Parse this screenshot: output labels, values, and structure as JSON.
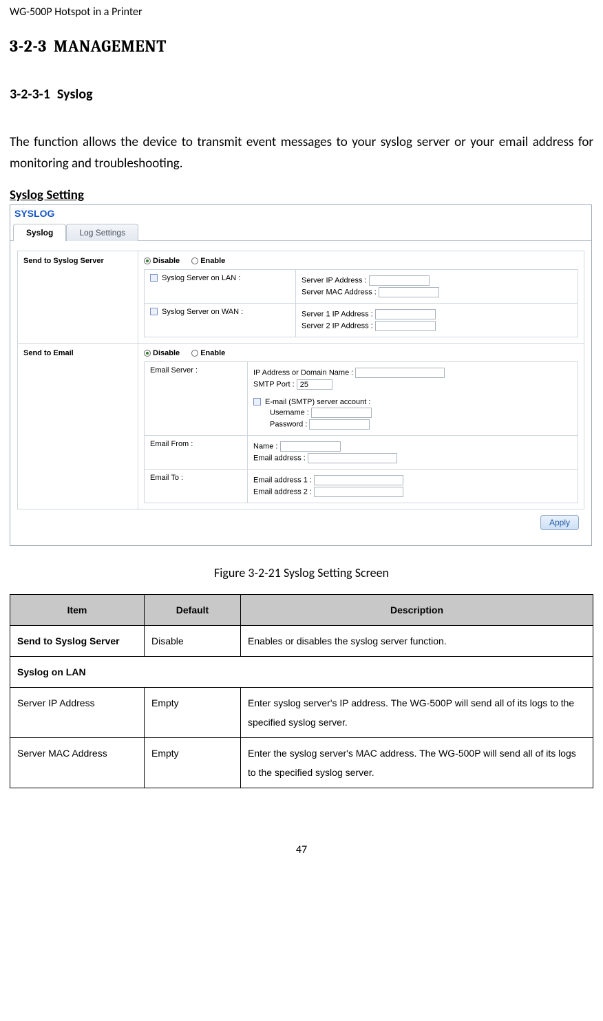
{
  "doc_header": "WG-500P Hotspot in a Printer",
  "section": {
    "num": "3-2-3",
    "title": "MANAGEMENT"
  },
  "subsection": {
    "num": "3-2-3-1",
    "title": "Syslog"
  },
  "intro": "The function allows the device to transmit event messages to your syslog server or your email address for monitoring and troubleshooting.",
  "setting_heading": "Syslog Setting",
  "shot": {
    "title": "SYSLOG",
    "tabs": {
      "active": "Syslog",
      "inactive": "Log Settings"
    },
    "row_syslog_label": "Send to Syslog Server",
    "radio_disable": "Disable",
    "radio_enable": "Enable",
    "lan_label": "Syslog Server on LAN :",
    "lan_ip": "Server IP Address :",
    "lan_mac": "Server MAC Address :",
    "wan_label": "Syslog Server on WAN :",
    "wan_ip1": "Server 1 IP Address :",
    "wan_ip2": "Server 2 IP Address :",
    "row_email_label": "Send to Email",
    "email_server_label": "Email Server :",
    "email_ipdomain": "IP Address or Domain Name :",
    "email_smtp": "SMTP Port :",
    "email_smtp_val": "25",
    "email_acct": "E-mail (SMTP) server account :",
    "email_user": "Username :",
    "email_pass": "Password :",
    "email_from_label": "Email From :",
    "email_from_name": "Name :",
    "email_from_addr": "Email address :",
    "email_to_label": "Email To :",
    "email_to1": "Email address 1 :",
    "email_to2": "Email address 2 :",
    "apply": "Apply"
  },
  "figure_caption": "Figure 3-2-21 Syslog Setting Screen",
  "table": {
    "headers": {
      "item": "Item",
      "def": "Default",
      "desc": "Description"
    },
    "rows": [
      {
        "item": "Send to Syslog Server",
        "def": "Disable",
        "desc": "Enables or disables the syslog server function.",
        "bold_item": true
      },
      {
        "section": "Syslog on LAN"
      },
      {
        "item": "Server IP Address",
        "def": "Empty",
        "desc": "Enter syslog server's IP address. The WG-500P will send all of its logs to the specified syslog server."
      },
      {
        "item": "Server MAC Address",
        "def": "Empty",
        "desc": "Enter the syslog server's MAC address. The WG-500P will send all of its logs to the specified syslog server."
      }
    ]
  },
  "page_number": "47"
}
